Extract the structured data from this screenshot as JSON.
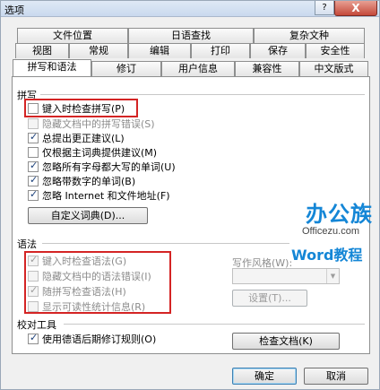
{
  "window": {
    "title": "选项",
    "help_label": "?",
    "close_label": "X"
  },
  "tabs_row1": [
    "文件位置",
    "日语查找",
    "复杂文种"
  ],
  "tabs_row2": [
    "视图",
    "常规",
    "编辑",
    "打印",
    "保存",
    "安全性"
  ],
  "tabs_row3": [
    "拼写和语法",
    "修订",
    "用户信息",
    "兼容性",
    "中文版式"
  ],
  "spelling": {
    "heading": "拼写",
    "items": [
      {
        "label": "键入时检查拼写(P)",
        "checked": false,
        "disabled": false
      },
      {
        "label": "隐藏文档中的拼写错误(S)",
        "checked": false,
        "disabled": true
      },
      {
        "label": "总提出更正建议(L)",
        "checked": true,
        "disabled": false
      },
      {
        "label": "仅根据主词典提供建议(M)",
        "checked": false,
        "disabled": false
      },
      {
        "label": "忽略所有字母都大写的单词(U)",
        "checked": true,
        "disabled": false
      },
      {
        "label": "忽略带数字的单词(B)",
        "checked": true,
        "disabled": false
      },
      {
        "label": "忽略 Internet 和文件地址(F)",
        "checked": true,
        "disabled": false
      }
    ],
    "custom_dict_button": "自定义词典(D)..."
  },
  "grammar": {
    "heading": "语法",
    "items": [
      {
        "label": "键入时检查语法(G)",
        "checked": true,
        "disabled": true
      },
      {
        "label": "隐藏文档中的语法错误(I)",
        "checked": false,
        "disabled": true
      },
      {
        "label": "随拼写检查语法(H)",
        "checked": true,
        "disabled": true
      },
      {
        "label": "显示可读性统计信息(R)",
        "checked": false,
        "disabled": true
      }
    ],
    "style_label": "写作风格(W):",
    "style_value": "",
    "settings_button": "设置(T)..."
  },
  "proofing": {
    "heading": "校对工具",
    "item": {
      "label": "使用德语后期修订规则(O)",
      "checked": true,
      "disabled": false
    },
    "recheck_button": "检查文档(K)"
  },
  "footer": {
    "ok": "确定",
    "cancel": "取消"
  },
  "watermark": {
    "brand": "办公族",
    "site": "Officezu.com",
    "tagline": "Word教程"
  },
  "colors": {
    "highlight": "#d42424",
    "watermark": "#1486d6"
  }
}
